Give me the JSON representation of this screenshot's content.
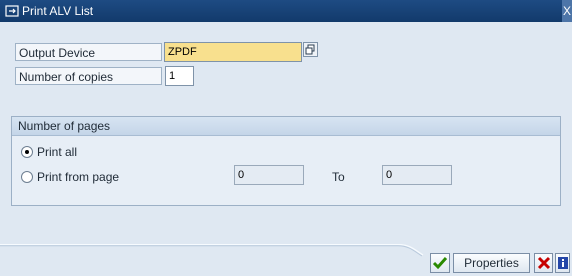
{
  "window": {
    "title": "Print ALV List",
    "close_glyph": "X"
  },
  "fields": {
    "output_device": {
      "label": "Output Device",
      "value": "ZPDF"
    },
    "number_of_copies": {
      "label": "Number of copies",
      "value": "1"
    }
  },
  "pages_group": {
    "title": "Number of pages",
    "print_all": {
      "label": "Print all",
      "selected": true
    },
    "print_from": {
      "label": "Print from page",
      "selected": false,
      "from_value": "0",
      "to_label": "To",
      "to_value": "0"
    }
  },
  "footer": {
    "properties_label": "Properties"
  },
  "icons": [
    "print-icon",
    "search-help-icon",
    "confirm-check-icon",
    "cancel-x-icon",
    "info-icon"
  ],
  "colors": {
    "title_bar": "#123a6b",
    "highlight_field": "#f8e08e",
    "confirm_green": "#2a8a00",
    "cancel_red": "#c60000",
    "info_blue": "#2446a8"
  }
}
